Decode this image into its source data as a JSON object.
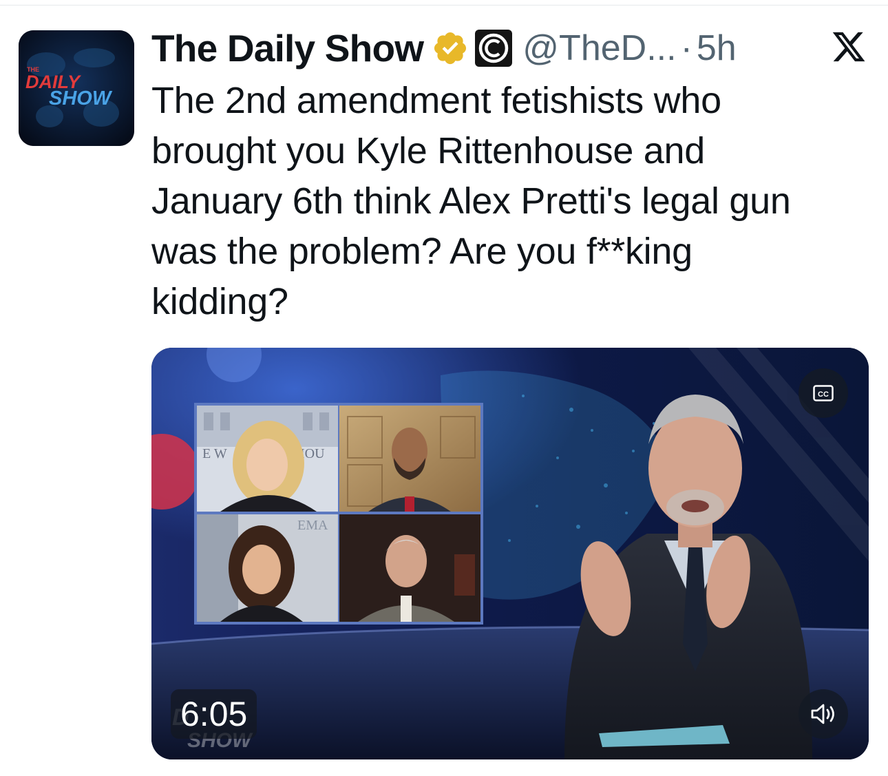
{
  "tweet": {
    "author_name": "The Daily Show",
    "handle": "@TheD...",
    "separator": "·",
    "time": "5h",
    "avatar_text": {
      "the": "THE",
      "daily": "DAILY",
      "show": "SHOW"
    },
    "text_lines": [
      "The 2nd amendment fetishists who",
      "brought you Kyle Rittenhouse and",
      "January 6th think Alex Pretti's legal gun",
      "was the problem? Are you f**king",
      "kidding?"
    ]
  },
  "video": {
    "duration": "6:05",
    "background_sign_text": {
      "left": "E W",
      "right": "IOU",
      "lower": "EMA"
    },
    "watermark": {
      "daily": "D",
      "show": "SHOW"
    }
  },
  "icons": {
    "verified": "verified-badge-icon",
    "brand": "comedy-central-icon",
    "platform": "x-logo-icon",
    "cc": "closed-captions-icon",
    "volume": "volume-icon"
  },
  "colors": {
    "verified_gold": "#e8b829",
    "handle_gray": "#536471",
    "text": "#0f1419"
  }
}
